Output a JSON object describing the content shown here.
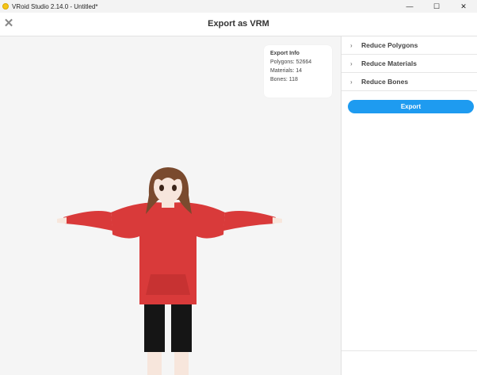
{
  "titlebar": {
    "title": "VRoid Studio 2.14.0 - Untitled*",
    "minimize": "—",
    "maximize": "☐",
    "close": "✕"
  },
  "header": {
    "title": "Export as VRM",
    "close_glyph": "✕"
  },
  "export_info": {
    "title": "Export Info",
    "polygons": "Polygons: 52664",
    "materials": "Materials: 14",
    "bones": "Bones: 118"
  },
  "panel": {
    "sections": [
      {
        "label": "Reduce Polygons"
      },
      {
        "label": "Reduce Materials"
      },
      {
        "label": "Reduce Bones"
      }
    ],
    "export_label": "Export"
  },
  "colors": {
    "accent": "#1e9bf0",
    "hoodie": "#d93a3a",
    "hair": "#7a4a2e",
    "skin": "#f7e6dc"
  }
}
